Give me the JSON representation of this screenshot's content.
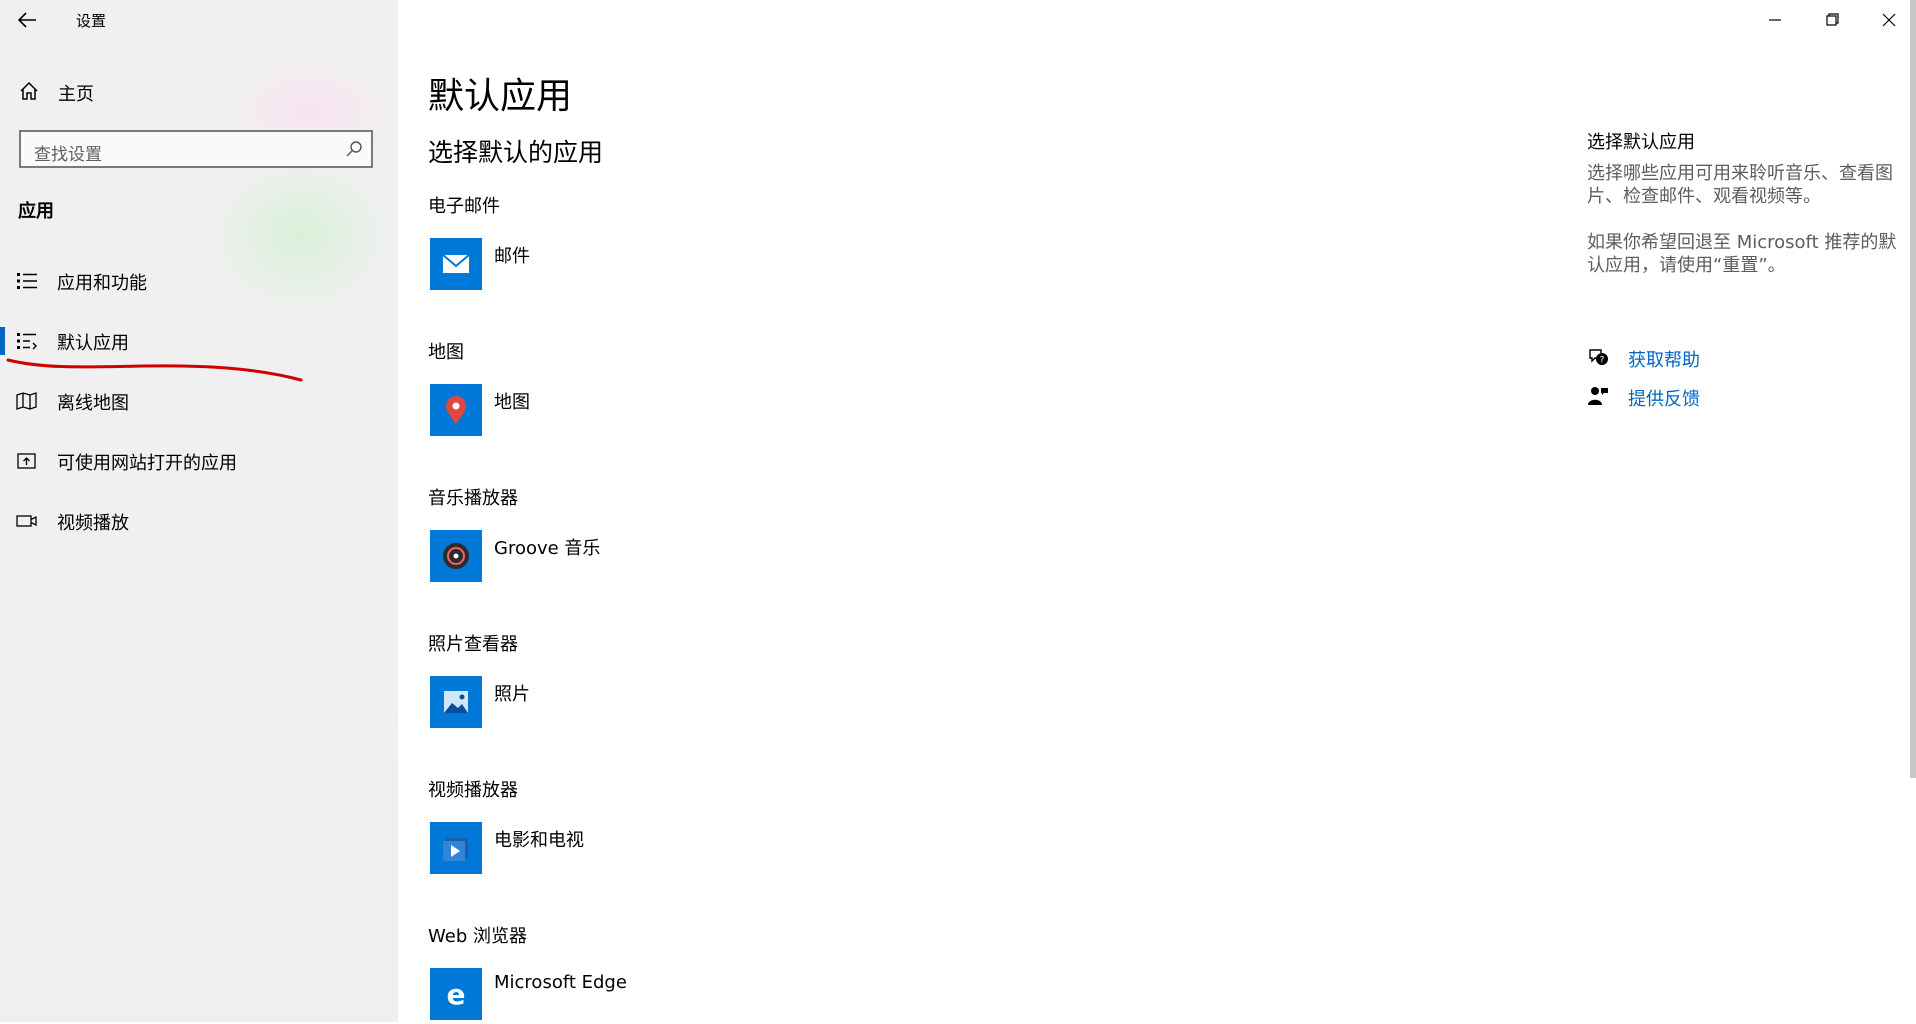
{
  "window": {
    "title": "设置"
  },
  "sidebar": {
    "home_label": "主页",
    "search_placeholder": "查找设置",
    "section_title": "应用",
    "items": [
      {
        "label": "应用和功能",
        "icon": "apps-list-icon"
      },
      {
        "label": "默认应用",
        "icon": "default-apps-icon",
        "selected": true
      },
      {
        "label": "离线地图",
        "icon": "offline-map-icon"
      },
      {
        "label": "可使用网站打开的应用",
        "icon": "open-with-website-icon"
      },
      {
        "label": "视频播放",
        "icon": "video-playback-icon"
      }
    ]
  },
  "main": {
    "page_title": "默认应用",
    "subtitle": "选择默认的应用",
    "defaults": [
      {
        "category": "电子邮件",
        "app": "邮件",
        "icon": "mail-icon"
      },
      {
        "category": "地图",
        "app": "地图",
        "icon": "maps-icon"
      },
      {
        "category": "音乐播放器",
        "app": "Groove 音乐",
        "icon": "groove-music-icon"
      },
      {
        "category": "照片查看器",
        "app": "照片",
        "icon": "photos-icon"
      },
      {
        "category": "视频播放器",
        "app": "电影和电视",
        "icon": "movies-tv-icon"
      },
      {
        "category": "Web 浏览器",
        "app": "Microsoft Edge",
        "icon": "edge-icon"
      }
    ]
  },
  "right_panel": {
    "title": "选择默认应用",
    "desc1_line1": "选择哪些应用可用来聆听音乐、查看图",
    "desc1_line2": "片、检查邮件、观看视频等。",
    "desc2_line1": "如果你希望回退至 Microsoft 推荐的默",
    "desc2_line2": "认应用，请使用“重置”。",
    "help_link": "获取帮助",
    "feedback_link": "提供反馈"
  },
  "colors": {
    "accent": "#0067c0",
    "tile": "#0078d7",
    "annotation": "#d00000"
  }
}
